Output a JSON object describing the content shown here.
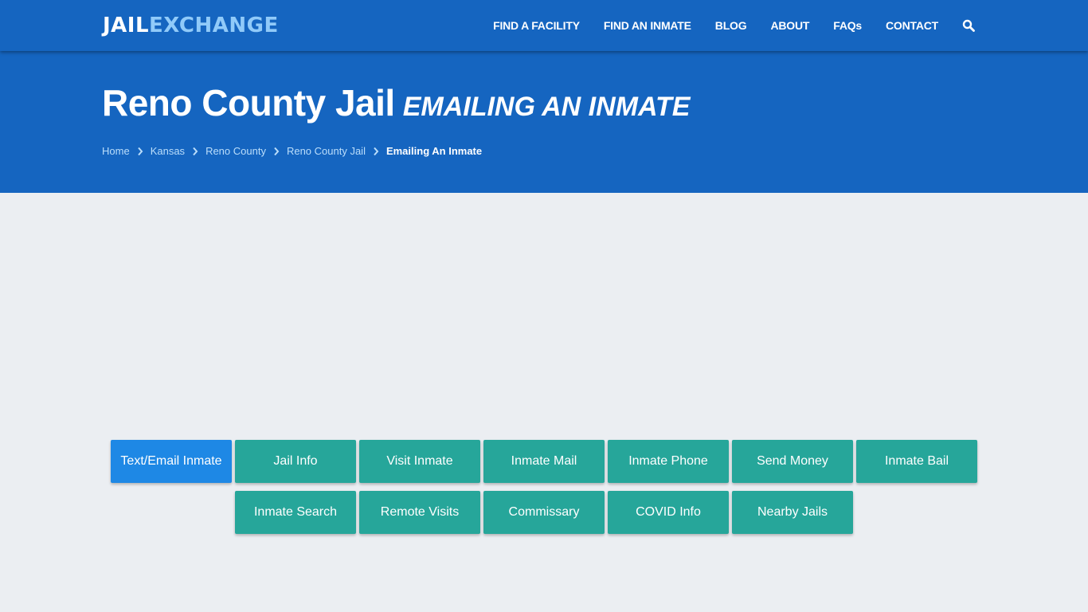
{
  "brand": {
    "part1": "JAIL",
    "part2": "EXCHANGE"
  },
  "nav": {
    "items": [
      "FIND A FACILITY",
      "FIND AN INMATE",
      "BLOG",
      "ABOUT",
      "FAQs",
      "CONTACT"
    ],
    "search_icon": "search-icon"
  },
  "hero": {
    "title": "Reno County Jail",
    "subtitle": "Emailing an Inmate"
  },
  "breadcrumb": {
    "items": [
      "Home",
      "Kansas",
      "Reno County",
      "Reno County Jail"
    ],
    "current": "Emailing An Inmate"
  },
  "buttons": {
    "row1": [
      "Text/Email Inmate",
      "Jail Info",
      "Visit Inmate",
      "Inmate Mail",
      "Inmate Phone",
      "Send Money",
      "Inmate Bail"
    ],
    "row2": [
      "Inmate Search",
      "Remote Visits",
      "Commissary",
      "COVID Info",
      "Nearby Jails"
    ],
    "active": "Text/Email Inmate"
  },
  "colors": {
    "primary": "#1565c0",
    "button": "#26a69a",
    "button_active": "#1e88e5",
    "logo_accent": "#90caf9",
    "background": "#ebeef2"
  }
}
